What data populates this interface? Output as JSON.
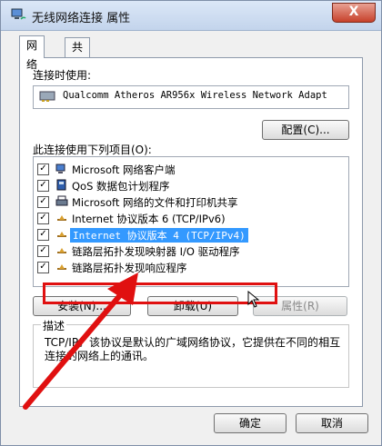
{
  "window": {
    "title": "无线网络连接 属性",
    "close_glyph": "X"
  },
  "tabs": [
    {
      "label": "网络",
      "active": true
    },
    {
      "label": "共享",
      "active": false
    }
  ],
  "connect_using": {
    "label": "连接时使用:",
    "adapter": "Qualcomm Atheros AR956x Wireless Network Adapt"
  },
  "buttons": {
    "configure": "配置(C)...",
    "install": "安装(N)...",
    "uninstall": "卸载(U)",
    "properties": "属性(R)",
    "ok": "确定",
    "cancel": "取消"
  },
  "items_label": "此连接使用下列项目(O):",
  "items": [
    {
      "label": "Microsoft 网络客户端",
      "checked": true,
      "icon": "network-client-icon"
    },
    {
      "label": "QoS 数据包计划程序",
      "checked": true,
      "icon": "qos-icon"
    },
    {
      "label": "Microsoft 网络的文件和打印机共享",
      "checked": true,
      "icon": "printer-sharing-icon"
    },
    {
      "label": "Internet 协议版本 6 (TCP/IPv6)",
      "checked": true,
      "icon": "protocol-icon"
    },
    {
      "label": "Internet 协议版本 4 (TCP/IPv4)",
      "checked": true,
      "icon": "protocol-icon",
      "selected": true
    },
    {
      "label": "链路层拓扑发现映射器 I/O 驱动程序",
      "checked": true,
      "icon": "protocol-icon"
    },
    {
      "label": "链路层拓扑发现响应程序",
      "checked": true,
      "icon": "protocol-icon"
    }
  ],
  "description": {
    "legend": "描述",
    "text": "TCP/IP。该协议是默认的广域网络协议，它提供在不同的相互连接的网络上的通讯。"
  },
  "colors": {
    "highlight_border": "#e01010",
    "selection": "#3399ff",
    "arrow": "#e01010"
  }
}
